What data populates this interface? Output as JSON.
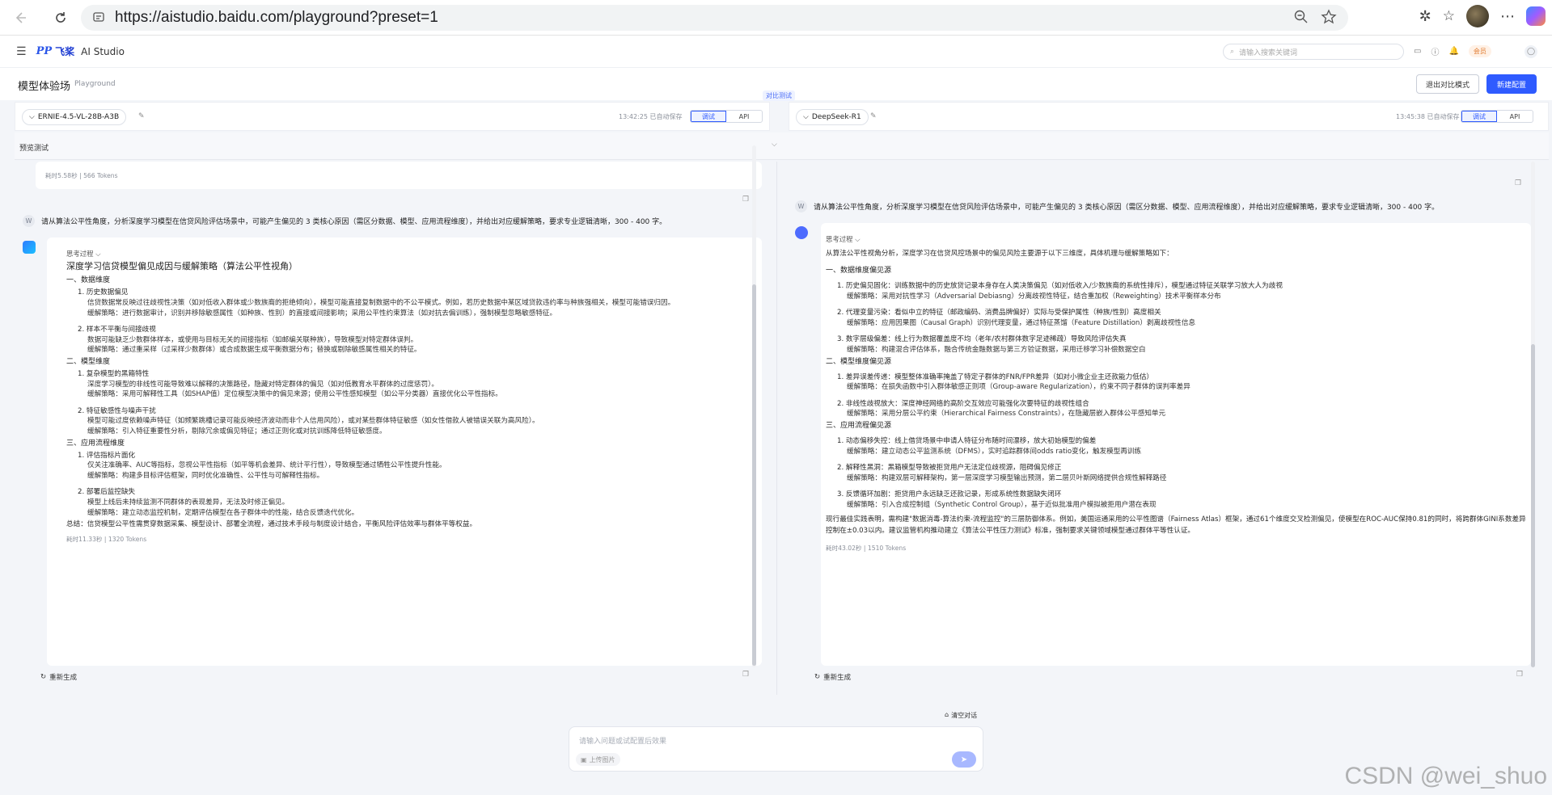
{
  "browser": {
    "url": "https://aistudio.baidu.com/playground?preset=1"
  },
  "app": {
    "logo_mark": "飞桨",
    "logo_prefix": "PP",
    "logo_sub": "AI Studio",
    "search_placeholder": "请输入搜索关键词",
    "vip_label": "会员"
  },
  "page": {
    "title": "模型体验场",
    "subtitle": "Playground",
    "compare_label": "对比测试",
    "exit_compare": "退出对比模式",
    "new_config": "新建配置",
    "preview_label": "预览测试"
  },
  "left_model": {
    "name": "ERNIE-4.5-VL-28B-A3B",
    "time": "13:42:25 已自动保存",
    "seg_debug": "调试",
    "seg_api": "API",
    "prev_meta": "耗时5.58秒 | 566 Tokens",
    "user_msg": "请从算法公平性角度，分析深度学习模型在信贷风险评估场景中，可能产生偏见的 3 类核心原因（需区分数据、模型、应用流程维度），并给出对应缓解策略，要求专业逻辑清晰，300 - 400 字。",
    "user_avatar": "W",
    "think_label": "思考过程",
    "title": "深度学习信贷模型偏见成因与缓解策略（算法公平性视角）",
    "sections": [
      {
        "heading": "一、数据维度",
        "items": [
          {
            "title": "1. 历史数据偏见",
            "lines": [
              "信贷数据常反映过往歧视性决策（如对低收入群体或少数族裔的拒绝倾向），模型可能直接复制数据中的不公平模式。例如，若历史数据中某区域贷款违约率与种族强相关，模型可能错误归因。",
              "缓解策略：进行数据审计，识别并移除敏感属性（如种族、性别）的直接或间接影响；采用公平性约束算法（如对抗去偏训练），强制模型忽略敏感特征。"
            ]
          },
          {
            "title": "2. 样本不平衡与间接歧视",
            "lines": [
              "数据可能缺乏少数群体样本，或使用与目标无关的间接指标（如邮编关联种族），导致模型对特定群体误判。",
              "缓解策略：通过重采样（过采样少数群体）或合成数据生成平衡数据分布；替换或剔除敏感属性相关的特征。"
            ]
          }
        ]
      },
      {
        "heading": "二、模型维度",
        "items": [
          {
            "title": "1. 复杂模型的黑箱特性",
            "lines": [
              "深度学习模型的非线性可能导致难以解释的决策路径，隐藏对特定群体的偏见（如对低教育水平群体的过度惩罚）。",
              "缓解策略：采用可解释性工具（如SHAP值）定位模型决策中的偏见来源；使用公平性感知模型（如公平分类器）直接优化公平性指标。"
            ]
          },
          {
            "title": "2. 特征敏感性与噪声干扰",
            "lines": [
              "模型可能过度依赖噪声特征（如频繁跳槽记录可能反映经济波动而非个人信用风险），或对某些群体特征敏感（如女性借款人被错误关联为高风险）。",
              "缓解策略：引入特征重要性分析，剔除冗余或偏见特征；通过正则化或对抗训练降低特征敏感度。"
            ]
          }
        ]
      },
      {
        "heading": "三、应用流程维度",
        "items": [
          {
            "title": "1. 评估指标片面化",
            "lines": [
              "仅关注准确率、AUC等指标，忽视公平性指标（如平等机会差异、统计平行性），导致模型通过牺牲公平性提升性能。",
              "缓解策略：构建多目标评估框架，同时优化准确性、公平性与可解释性指标。"
            ]
          },
          {
            "title": "2. 部署后监控缺失",
            "lines": [
              "模型上线后未持续监测不同群体的表现差异，无法及时修正偏见。",
              "缓解策略：建立动态监控机制，定期评估模型在各子群体中的性能，结合反馈迭代优化。"
            ]
          }
        ]
      }
    ],
    "summary": "总结：信贷模型公平性需贯穿数据采集、模型设计、部署全流程，通过技术手段与制度设计结合，平衡风险评估效率与群体平等权益。",
    "meta": "耗时11.33秒 | 1320 Tokens",
    "regen": "重新生成"
  },
  "right_model": {
    "name": "DeepSeek-R1",
    "time": "13:45:38 已自动保存",
    "seg_debug": "调试",
    "seg_api": "API",
    "user_msg": "请从算法公平性角度，分析深度学习模型在信贷风险评估场景中，可能产生偏见的 3 类核心原因（需区分数据、模型、应用流程维度），并给出对应缓解策略，要求专业逻辑清晰，300 - 400 字。",
    "user_avatar": "W",
    "think_label": "思考过程",
    "intro": "从算法公平性视角分析，深度学习在信贷风控场景中的偏见风险主要源于以下三维度，具体机理与缓解策略如下：",
    "sections": [
      {
        "heading": "一、数据维度偏见源",
        "items": [
          {
            "title": "1. 历史偏见固化：训练数据中的历史放贷记录本身存在人类决策偏见（如对低收入/少数族裔的系统性排斥），模型通过特征关联学习放大人为歧视",
            "lines": [
              "缓解策略：采用对抗性学习（Adversarial Debiasng）分离歧视性特征，结合重加权（Reweighting）技术平衡样本分布"
            ]
          },
          {
            "title": "2. 代理变量污染：看似中立的特征（邮政编码、消费品牌偏好）实际与受保护属性（种族/性别）高度相关",
            "lines": [
              "缓解策略：应用因果图（Causal Graph）识别代理变量，通过特征蒸馏（Feature Distillation）剥离歧视性信息"
            ]
          },
          {
            "title": "3. 数字层级偏差：线上行为数据覆盖度不均（老年/农村群体数字足迹稀疏）导致风险评估失真",
            "lines": [
              "缓解策略：构建混合评估体系，融合传统金融数据与第三方验证数据，采用迁移学习补偿数据空白"
            ]
          }
        ]
      },
      {
        "heading": "二、模型维度偏见源",
        "items": [
          {
            "title": "1. 差异误差传递：模型整体准确率掩盖了特定子群体的FNR/FPR差异（如对小微企业主还款能力低估）",
            "lines": [
              "缓解策略：在损失函数中引入群体敏感正则项（Group-aware Regularization），约束不同子群体的误判率差异"
            ]
          },
          {
            "title": "2. 非线性歧视放大：深度神经网络的高阶交互效应可能强化次要特征的歧视性组合",
            "lines": [
              "缓解策略：采用分层公平约束（Hierarchical Fairness Constraints），在隐藏层嵌入群体公平感知单元"
            ]
          }
        ]
      },
      {
        "heading": "三、应用流程偏见源",
        "items": [
          {
            "title": "1. 动态偏移失控：线上借贷场景中申请人特征分布随时间漂移，放大初始模型的偏差",
            "lines": [
              "缓解策略：建立动态公平监测系统（DFMS），实时追踪群体间odds ratio变化，触发模型再训练"
            ]
          },
          {
            "title": "2. 解释性黑洞：黑箱模型导致被拒贷用户无法定位歧视源，阻碍偏见修正",
            "lines": [
              "缓解策略：构建双层可解释架构，第一层深度学习模型输出预测，第二层贝叶斯网络提供合规性解释路径"
            ]
          },
          {
            "title": "3. 反馈循环加剧：拒贷用户永远缺乏还款记录，形成系统性数据缺失闭环",
            "lines": [
              "缓解策略：引入合成控制组（Synthetic Control Group），基于近似批准用户模拟被拒用户潜在表现"
            ]
          }
        ]
      }
    ],
    "summary": "现行最佳实践表明，需构建\"数据消毒-算法约束-流程监控\"的三层防御体系。例如，美国运通采用的公平性图谱（Fairness Atlas）框架，通过61个维度交叉检测偏见，使模型在ROC-AUC保持0.81的同时，将跨群体GINI系数差异控制在±0.03以内。建议监管机构推动建立《算法公平性压力测试》标准，强制要求关键领域模型通过群体平等性认证。",
    "meta": "耗时43.02秒 | 1510 Tokens",
    "regen": "重新生成"
  },
  "bottom": {
    "clear": "清空对话",
    "input_placeholder": "请输入问题或试配置后效果",
    "upload": "上传图片"
  },
  "watermark": "CSDN @wei_shuo"
}
